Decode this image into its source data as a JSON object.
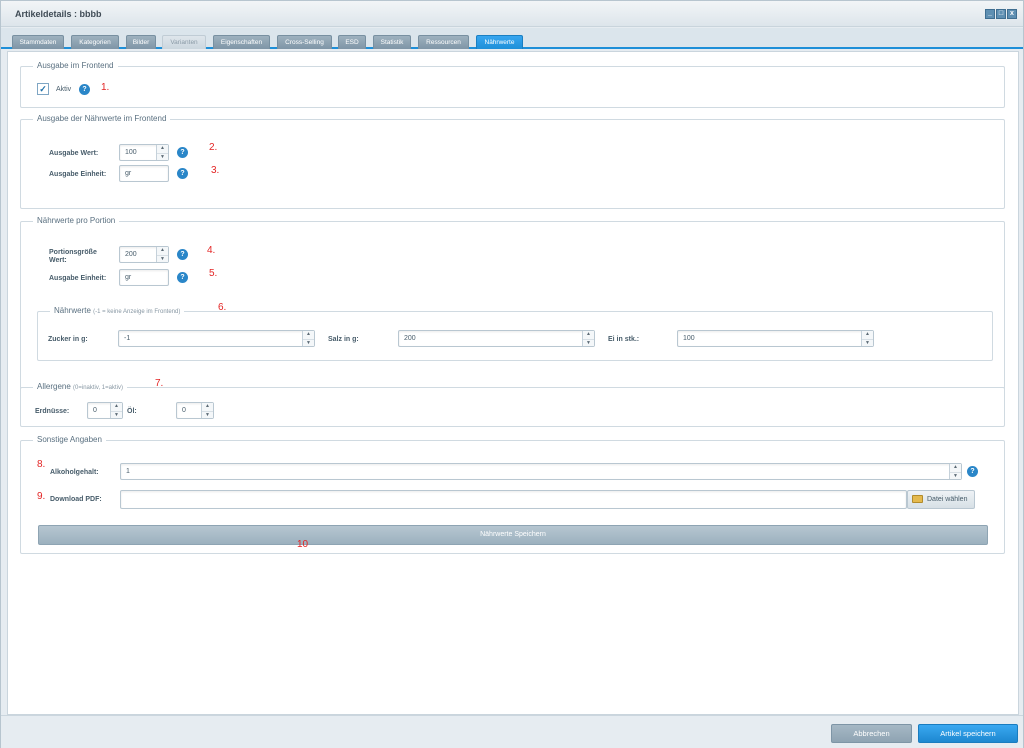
{
  "window": {
    "title": "Artikeldetails : bbbb"
  },
  "window_controls": {
    "minimize": "_",
    "maximize": "□",
    "close": "x"
  },
  "tabs": [
    {
      "label": "Stammdaten",
      "state": "normal"
    },
    {
      "label": "Kategorien",
      "state": "normal"
    },
    {
      "label": "Bilder",
      "state": "normal"
    },
    {
      "label": "Varianten",
      "state": "disabled"
    },
    {
      "label": "Eigenschaften",
      "state": "normal"
    },
    {
      "label": "Cross-Selling",
      "state": "normal"
    },
    {
      "label": "ESD",
      "state": "normal"
    },
    {
      "label": "Statistik",
      "state": "normal"
    },
    {
      "label": "Ressourcen",
      "state": "normal"
    },
    {
      "label": "Nährwerte",
      "state": "active"
    }
  ],
  "frontend": {
    "legend": "Ausgabe im Frontend",
    "aktiv_label": "Aktiv",
    "aktiv_checked": true,
    "checkmark": "✓"
  },
  "naehrwerte_frontend": {
    "legend": "Ausgabe der Nährwerte im Frontend",
    "wert_label": "Ausgabe Wert:",
    "wert_value": "100",
    "einheit_label": "Ausgabe Einheit:",
    "einheit_value": "gr"
  },
  "portion": {
    "legend": "Nährwerte pro Portion",
    "groesse_label": "Portionsgröße Wert:",
    "groesse_value": "200",
    "einheit_label": "Ausgabe Einheit:",
    "einheit_value": "gr"
  },
  "naehrwerte": {
    "legend": "Nährwerte",
    "legend_hint": "(-1 = keine Anzeige im Frontend)",
    "zucker_label": "Zucker in g:",
    "zucker_value": "-1",
    "salz_label": "Salz in g:",
    "salz_value": "200",
    "ei_label": "Ei in stk.:",
    "ei_value": "100"
  },
  "allergene": {
    "legend": "Allergene",
    "legend_hint": "(0=inaktiv, 1=aktiv)",
    "erdnuesse_label": "Erdnüsse:",
    "erdnuesse_value": "0",
    "oel_label": "Öl:",
    "oel_value": "0"
  },
  "sonstige": {
    "legend": "Sonstige Angaben",
    "alkohol_label": "Alkoholgehalt:",
    "alkohol_value": "1",
    "pdf_label": "Download PDF:",
    "pdf_value": "",
    "file_button": "Datei wählen",
    "save_button": "Nährwerte Speichern"
  },
  "annotations": [
    "1.",
    "2.",
    "3.",
    "4.",
    "5.",
    "6.",
    "7.",
    "8.",
    "9.",
    "10"
  ],
  "spinner": {
    "up": "▲",
    "down": "▼"
  },
  "help_glyph": "?",
  "footer": {
    "cancel_label": "Abbrechen",
    "save_label": "Artikel speichern"
  },
  "colors": {
    "accent": "#1e8fd8",
    "annotation": "#e32424",
    "help": "#2a86c8"
  }
}
